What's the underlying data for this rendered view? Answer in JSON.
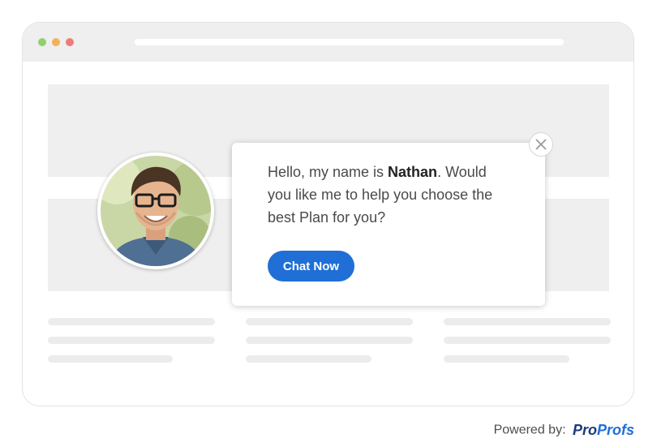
{
  "browser": {
    "dots": [
      "green",
      "yellow",
      "red"
    ]
  },
  "popup": {
    "message_prefix": "Hello, my name is ",
    "agent_name": "Nathan",
    "message_suffix": ". Would you like me to help you choose the best Plan for you?",
    "cta_label": "Chat Now",
    "close_icon": "close-icon"
  },
  "footer": {
    "powered_by": "Powered by:",
    "brand_part1": "Pro",
    "brand_part2": "Profs"
  },
  "colors": {
    "accent": "#1f6fd6",
    "brand_dark": "#1b3a78",
    "placeholder": "#efefef"
  }
}
